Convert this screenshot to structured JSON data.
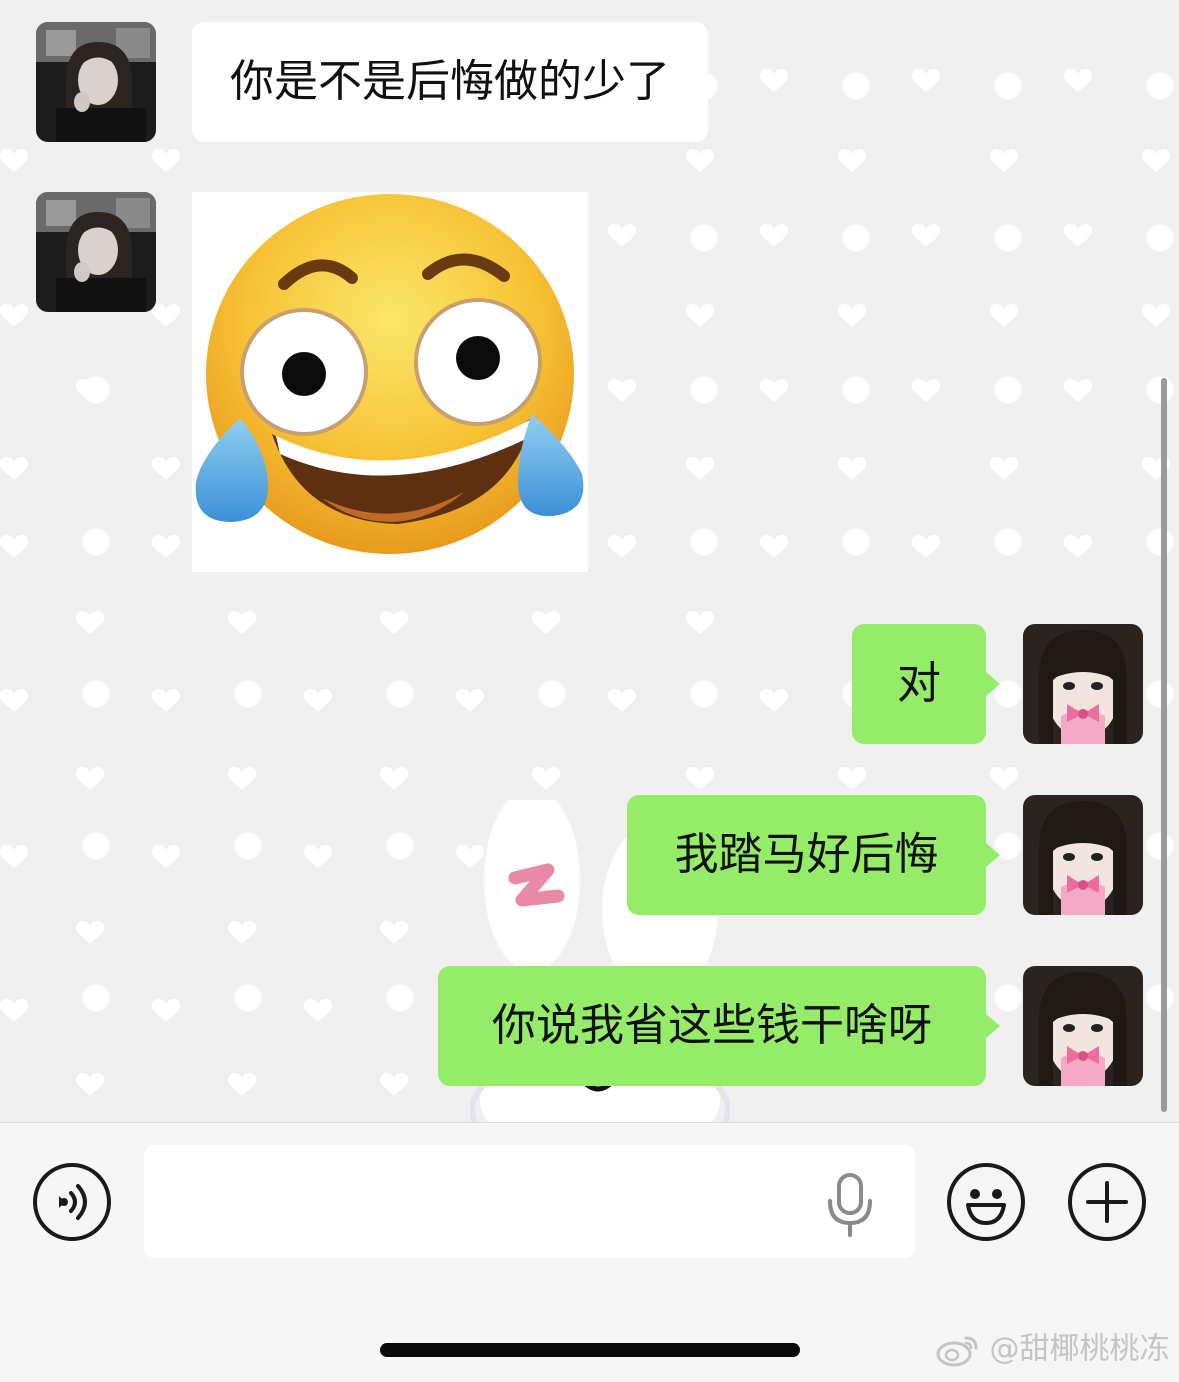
{
  "messages": [
    {
      "side": "left",
      "type": "text",
      "text": "你是不是后悔做的少了"
    },
    {
      "side": "left",
      "type": "sticker",
      "sticker": "laughing-crying-face-emoji"
    },
    {
      "side": "right",
      "type": "text",
      "text": "对"
    },
    {
      "side": "right",
      "type": "text",
      "text": "我踏马好后悔"
    },
    {
      "side": "right",
      "type": "text",
      "text": "你说我省这些钱干啥呀"
    }
  ],
  "input_bar": {
    "voice_icon": "voice-mode-icon",
    "text_value": "",
    "mic_icon": "microphone-icon",
    "emoji_icon": "smiley-icon",
    "more_icon": "plus-circle-icon"
  },
  "watermark": {
    "logo": "weibo-logo",
    "text": "@甜椰桃桃冻"
  },
  "colors": {
    "chat_background": "#f0f0f0",
    "incoming_bubble": "#ffffff",
    "outgoing_bubble": "#95ec69",
    "input_bar": "#f6f6f6"
  }
}
